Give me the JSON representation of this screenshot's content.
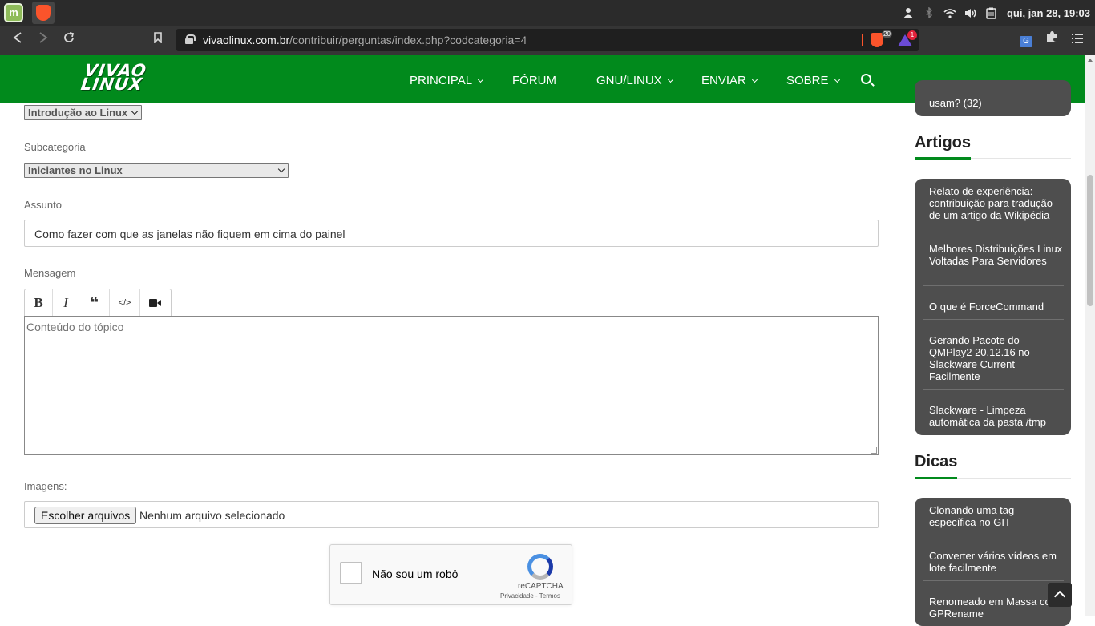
{
  "os": {
    "clock": "qui, jan 28, 19:03",
    "tray_icons": [
      "user-icon",
      "bluetooth-icon",
      "wifi-icon",
      "volume-icon",
      "clipboard-icon"
    ]
  },
  "browser": {
    "url_domain": "vivaolinux.com.br",
    "url_path": "/contribuir/perguntas/index.php?codcategoria=4",
    "shields_count": "20",
    "rewards_count": "1"
  },
  "site": {
    "logo_line1": "VIVAO",
    "logo_line2": "LINUX",
    "nav": [
      {
        "label": "PRINCIPAL"
      },
      {
        "label": "FÓRUM"
      },
      {
        "label": "GNU/LINUX"
      },
      {
        "label": "ENVIAR"
      },
      {
        "label": "SOBRE"
      }
    ]
  },
  "form": {
    "categoria_value": "Introdução ao Linux",
    "subcategoria_label": "Subcategoria",
    "subcategoria_value": "Iniciantes no Linux",
    "assunto_label": "Assunto",
    "assunto_value": "Como fazer com que as janelas não fiquem em cima do painel",
    "mensagem_label": "Mensagem",
    "toolbar": {
      "bold": "B",
      "italic": "I",
      "quote": "❝",
      "code": "</>"
    },
    "mensagem_placeholder": "Conteúdo do tópico",
    "imagens_label": "Imagens:",
    "file_button": "Escolher arquivos",
    "file_status": "Nenhum arquivo selecionado",
    "captcha_label": "Não sou um robô",
    "captcha_brand": "reCAPTCHA",
    "captcha_links": "Privacidade - Termos"
  },
  "sidebar": {
    "top_partial": "usam? (32)",
    "artigos_title": "Artigos",
    "artigos": [
      "Relato de experiência: contribuição para tradução de um artigo da Wikipédia",
      "Melhores Distribuições Linux Voltadas Para Servidores",
      "O que é ForceCommand",
      "Gerando Pacote do QMPlay2 20.12.16 no Slackware Current Facilmente",
      "Slackware - Limpeza automática da pasta /tmp"
    ],
    "dicas_title": "Dicas",
    "dicas": [
      "Clonando uma tag específica no GIT",
      "Converter vários vídeos em lote facilmente",
      "Renomeado em Massa com GPRename"
    ]
  },
  "colors": {
    "brand_green": "#018a1c",
    "sidebar_card": "#4e4e4e"
  }
}
